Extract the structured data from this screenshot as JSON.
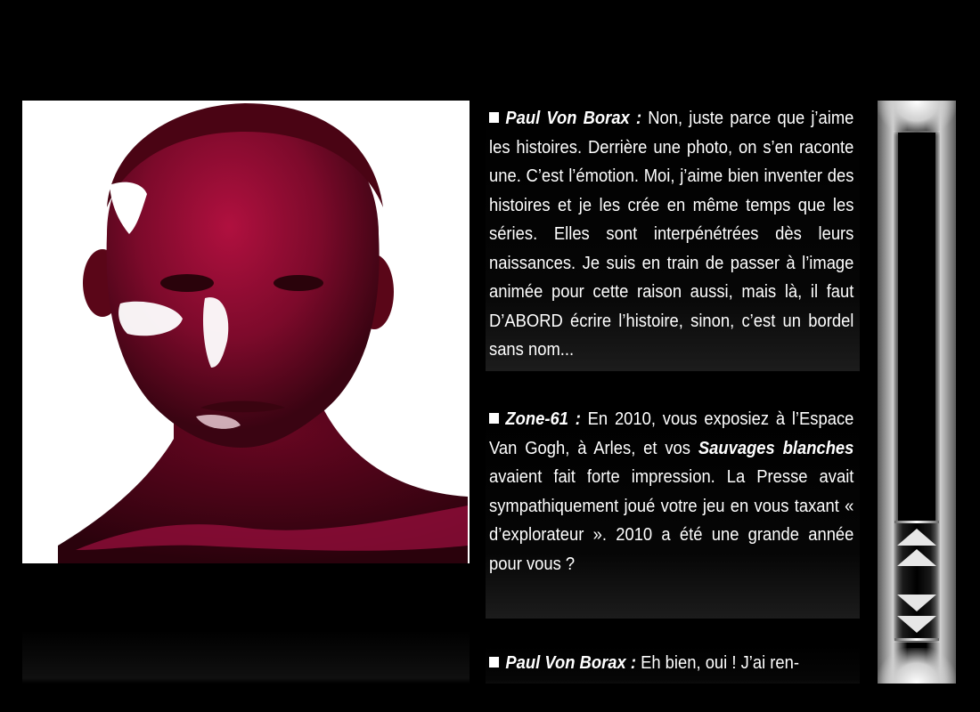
{
  "portrait": {
    "alt": "Portrait painted in magenta with white paint marks"
  },
  "interview": [
    {
      "speaker": "Paul Von Borax :",
      "text": " Non, juste parce que j’aime les histoires. Derrière une photo, on s’en raconte une. C’est l’émotion. Moi, j’aime bien inventer des histoires et je les crée en même temps que les séries. Elles sont interpénétrées dès leurs naissances. Je suis en train de passer à l’image animée pour cette raison aussi, mais là, il faut D’ABORD écrire l’histoire, sinon, c’est un bordel sans nom..."
    },
    {
      "speaker": "Zone-61 :",
      "text_before": " En 2010, vous exposiez à l’Espace Van Gogh, à Arles, et vos ",
      "emphasis": "Sauvages blanches",
      "text_after": " avaient fait forte impression. La Presse avait sympathiquement joué votre jeu en vous taxant « d’explorateur ». 2010 a été une grande année pour vous ?"
    },
    {
      "speaker": "Paul Von Borax :",
      "text": " Eh bien, oui ! J’ai ren-"
    }
  ],
  "scrollbar": {
    "up_icon": "double-chevron-up-icon",
    "down_icon": "double-chevron-down-icon"
  }
}
